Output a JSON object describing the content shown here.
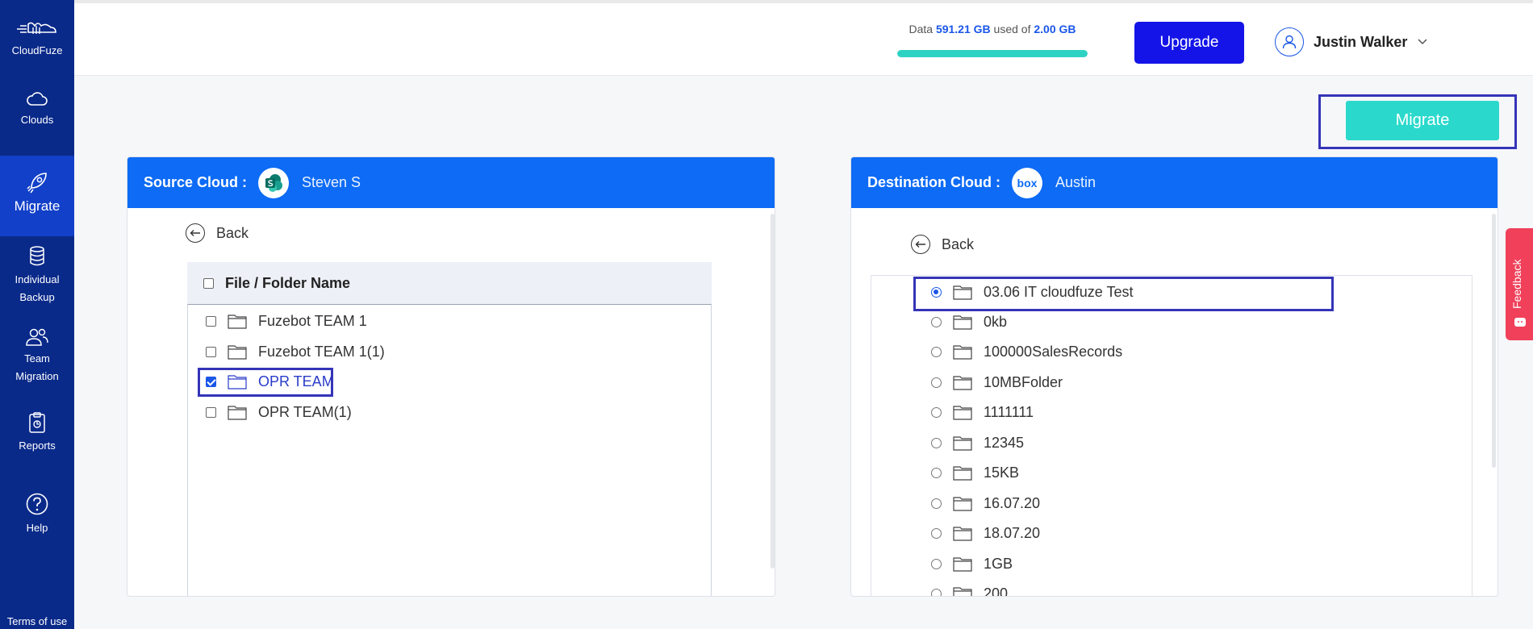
{
  "sidebar": {
    "brand": "CloudFuze",
    "items": [
      {
        "label": "Clouds"
      },
      {
        "label": "Migrate"
      },
      {
        "label_line1": "Individual",
        "label_line2": "Backup"
      },
      {
        "label_line1": "Team",
        "label_line2": "Migration"
      },
      {
        "label": "Reports"
      },
      {
        "label": "Help"
      }
    ],
    "terms": "Terms of use"
  },
  "header": {
    "usage_prefix": "Data",
    "usage_used": "591.21 GB",
    "usage_mid": "used of",
    "usage_total": "2.00 GB",
    "usage_fraction": 1.0,
    "upgrade_label": "Upgrade",
    "user_name": "Justin Walker"
  },
  "migrate_label": "Migrate",
  "source": {
    "title": "Source Cloud :",
    "account": "Steven S",
    "back_label": "Back",
    "column_header": "File / Folder Name",
    "items": [
      {
        "name": "Fuzebot TEAM 1",
        "checked": false
      },
      {
        "name": "Fuzebot TEAM 1(1)",
        "checked": false
      },
      {
        "name": "OPR TEAM",
        "checked": true
      },
      {
        "name": "OPR TEAM(1)",
        "checked": false
      }
    ]
  },
  "destination": {
    "title": "Destination Cloud :",
    "logo_text": "box",
    "account": "Austin",
    "back_label": "Back",
    "items": [
      {
        "name": "03.06 IT cloudfuze Test",
        "selected": true
      },
      {
        "name": "0kb",
        "selected": false
      },
      {
        "name": "100000SalesRecords",
        "selected": false
      },
      {
        "name": "10MBFolder",
        "selected": false
      },
      {
        "name": "1111111",
        "selected": false
      },
      {
        "name": "12345",
        "selected": false
      },
      {
        "name": "15KB",
        "selected": false
      },
      {
        "name": "16.07.20",
        "selected": false
      },
      {
        "name": "18.07.20",
        "selected": false
      },
      {
        "name": "1GB",
        "selected": false
      },
      {
        "name": "200",
        "selected": false
      }
    ]
  },
  "feedback_label": "Feedback",
  "colors": {
    "accent": "#0d6bf5",
    "sidebar": "#0a2a8a",
    "migrate": "#2ad9cc",
    "upgrade": "#1414e8",
    "highlight": "#3434b8"
  }
}
